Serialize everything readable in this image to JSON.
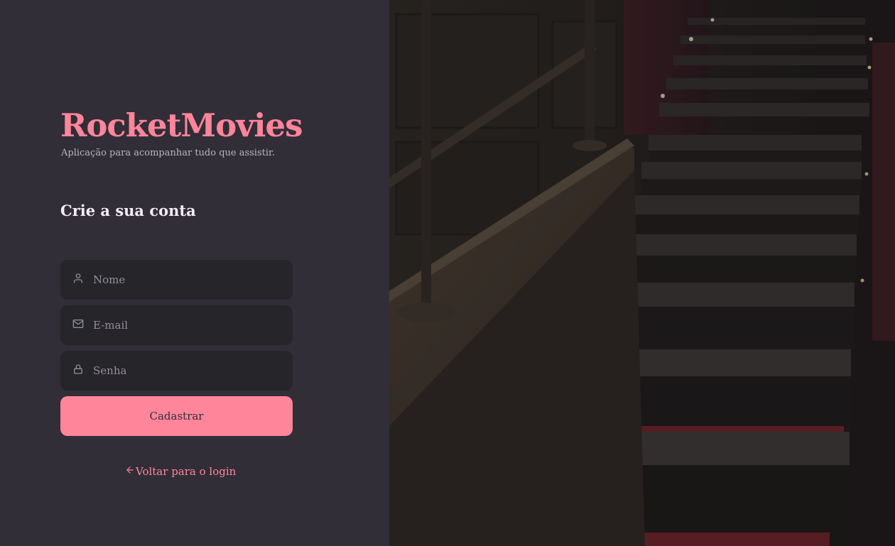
{
  "brand": {
    "title": "RocketMovies",
    "subtitle": "Aplicação para acompanhar tudo que assistir."
  },
  "form": {
    "heading": "Crie a sua conta",
    "fields": [
      {
        "placeholder": "Nome",
        "icon": "user-icon",
        "value": ""
      },
      {
        "placeholder": "E-mail",
        "icon": "mail-icon",
        "value": ""
      },
      {
        "placeholder": "Senha",
        "icon": "lock-icon",
        "value": ""
      }
    ],
    "submit_label": "Cadastrar",
    "back_link": {
      "label": "Voltar para o login",
      "icon": "arrow-left-icon"
    }
  },
  "background_image": {
    "subject": "cinema-staircase-photo"
  },
  "colors": {
    "accent": "#ff859b",
    "background": "#312e38",
    "input_background": "#262529",
    "heading_text": "#f4edf8",
    "placeholder_text": "#948f99"
  }
}
